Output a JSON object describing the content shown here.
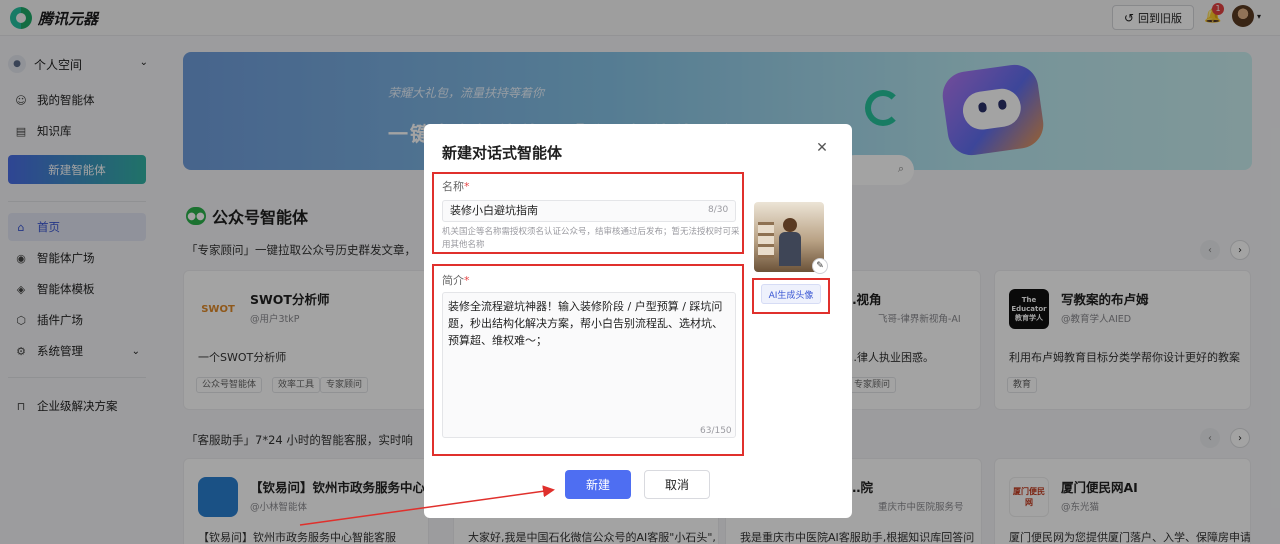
{
  "app": {
    "logo_text": "腾讯元器",
    "old_version_label": "回到旧版",
    "notification_count": "1"
  },
  "sidebar": {
    "space_label": "个人空间",
    "my_agents": "我的智能体",
    "knowledge": "知识库",
    "new_agent": "新建智能体",
    "home": "首页",
    "plaza": "智能体广场",
    "templates": "智能体模板",
    "plugins": "插件广场",
    "system": "系统管理",
    "enterprise": "企业级解决方案"
  },
  "banner": {
    "subtitle": "荣耀大礼包，流量扶持等着你",
    "title": "一键发布智能体到「腾讯智能体平台」"
  },
  "section_gzh": {
    "title": "公众号智能体",
    "desc": "「专家顾问」一键拉取公众号历史群发文章，"
  },
  "cards_row1": [
    {
      "icon_text": "SWOT",
      "name": "SWOT分析师",
      "author": "@用户3tkP",
      "desc": "一个SWOT分析师",
      "tags": [
        "公众号智能体",
        "效率工具",
        "专家顾问"
      ]
    },
    {
      "name": "…视角",
      "author": "飞哥-律界新视角-AI",
      "desc": "…律人执业困惑。",
      "tags": [
        "专家顾问"
      ]
    },
    {
      "icon_text": "The Educator 教育学人",
      "name": "写教案的布卢姆",
      "author": "@教育学人AIED",
      "desc": "利用布卢姆教育目标分类学帮你设计更好的教案",
      "tags": [
        "教育"
      ]
    }
  ],
  "section_kf": {
    "desc": "「客服助手」7*24 小时的智能客服，实时响"
  },
  "cards_row2": [
    {
      "name": "【钦易问】钦州市政务服务中心...",
      "author": "@小林智能体",
      "desc": "【钦易问】钦州市政务服务中心智能客服"
    },
    {
      "desc": "大家好,我是中国石化微信公众号的AI客服\"小石头\","
    },
    {
      "name": "…院",
      "author": "重庆市中医院服务号",
      "desc": "我是重庆市中医院AI客服助手,根据知识库回答问"
    },
    {
      "icon_text": "厦门便民网",
      "name": "厦门便民网AI",
      "author": "@东光猫",
      "desc": "厦门便民网为您提供厦门落户、入学、保障房申请"
    }
  ],
  "modal": {
    "title": "新建对话式智能体",
    "name_label": "名称",
    "name_value": "装修小白避坑指南",
    "name_count": "8/30",
    "name_hint": "机关国企等名称需授权须名认证公众号，结审核通过后发布；暂无法授权时可采用其他名称",
    "intro_label": "简介",
    "intro_value": "装修全流程避坑神器！输入装修阶段 / 户型预算 / 踩坑问题，秒出结构化解决方案，帮小白告别流程乱、选材坑、预算超、维权难～；",
    "intro_count": "63/150",
    "ai_avatar_label": "AI生成头像",
    "create_label": "新建",
    "cancel_label": "取消"
  },
  "colors": {
    "primary": "#4e6ef2",
    "highlight": "#e0302c",
    "required": "#e54545"
  }
}
